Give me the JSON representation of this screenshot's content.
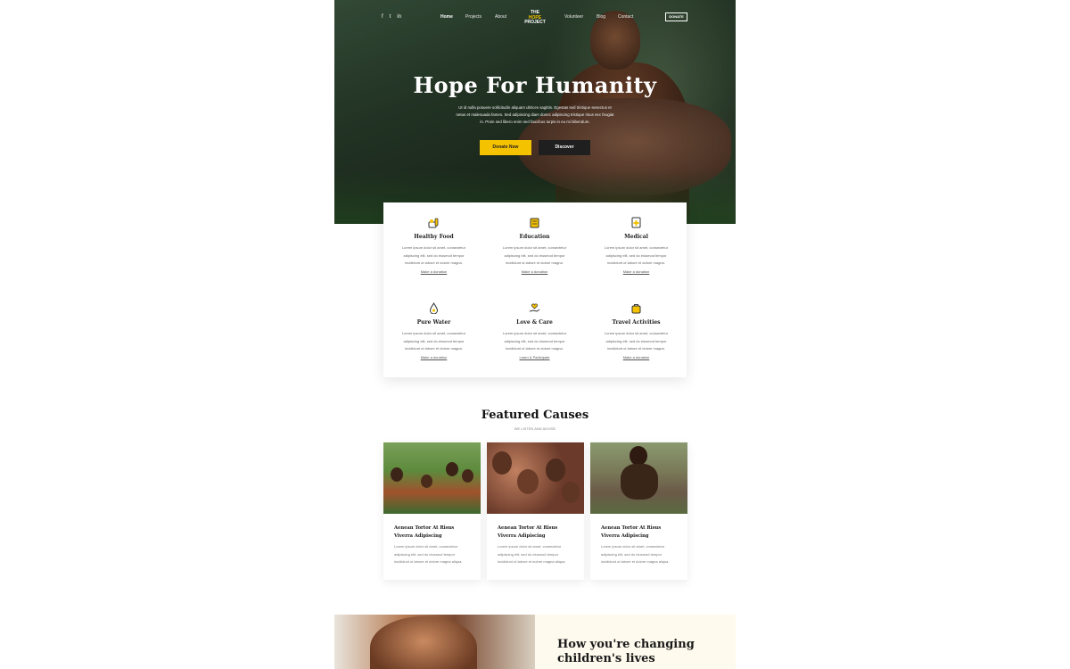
{
  "nav": {
    "social": [
      "f",
      "t",
      "in"
    ],
    "links": [
      "Home",
      "Projects",
      "About",
      "Volunteer",
      "Blog",
      "Contact"
    ],
    "logo": [
      "THE",
      "HOPE",
      "PROJECT"
    ],
    "donate": "DONATE"
  },
  "hero": {
    "title": "Hope For Humanity",
    "text": "Ut id nulla posuere sollicitudin aliquam ultrices sagittis. Egestas sed tristique senectus et netus et malesuada fames. Sed adipiscing diam donec adipiscing tristique risus nec feugiat in. Proin sed libero enim sed faucibus turpis in eu mi bibendum.",
    "donate_label": "Donate Now",
    "discover_label": "Discover"
  },
  "services": [
    {
      "title": "Healthy Food",
      "desc": "Lorem ipsum dolor sit amet, consectetur adipiscing elit, sed do eiusmod tempor incididunt ut labore et dolore magna.",
      "link": "Make a donation",
      "icon": "food-icon"
    },
    {
      "title": "Education",
      "desc": "Lorem ipsum dolor sit amet, consectetur adipiscing elit, sed do eiusmod tempor incididunt ut labore et dolore magna.",
      "link": "Make a donation",
      "icon": "book-icon"
    },
    {
      "title": "Medical",
      "desc": "Lorem ipsum dolor sit amet, consectetur adipiscing elit, sed do eiusmod tempor incididunt ut labore et dolore magna.",
      "link": "Make a donation",
      "icon": "medical-icon"
    },
    {
      "title": "Pure Water",
      "desc": "Lorem ipsum dolor sit amet, consectetur adipiscing elit, sed do eiusmod tempor incididunt ut labore et dolore magna.",
      "link": "Make a donation",
      "icon": "water-drop-icon"
    },
    {
      "title": "Love & Care",
      "desc": "Lorem ipsum dolor sit amet, consectetur adipiscing elit, sed do eiusmod tempor incididunt ut labore et dolore magna.",
      "link": "Learn & Participate",
      "icon": "heart-hand-icon"
    },
    {
      "title": "Travel Activities",
      "desc": "Lorem ipsum dolor sit amet, consectetur adipiscing elit, sed do eiusmod tempor incididunt ut labore et dolore magna.",
      "link": "Make a donation",
      "icon": "bag-icon"
    }
  ],
  "featured": {
    "title": "Featured Causes",
    "subtitle": "WE LISTEN AND ADVISE",
    "cards": [
      {
        "title": "Aenean Tortor At Risus Viverra Adipiscing",
        "desc": "Lorem ipsum dolor sit amet, consectetur adipiscing elit, sed do eiusmod tempor incididunt ut labore et dolore magna aliqua."
      },
      {
        "title": "Aenean Tortor At Risus Viverra Adipiscing",
        "desc": "Lorem ipsum dolor sit amet, consectetur adipiscing elit, sed do eiusmod tempor incididunt ut labore et dolore magna aliqua."
      },
      {
        "title": "Aenean Tortor At Risus Viverra Adipiscing",
        "desc": "Lorem ipsum dolor sit amet, consectetur adipiscing elit, sed do eiusmod tempor incididunt ut labore et dolore magna aliqua."
      }
    ]
  },
  "bottom": {
    "title": "How you're changing children's lives"
  },
  "colors": {
    "accent": "#f5c200",
    "dark": "#1f1f1f",
    "panel": "#fefaed"
  }
}
